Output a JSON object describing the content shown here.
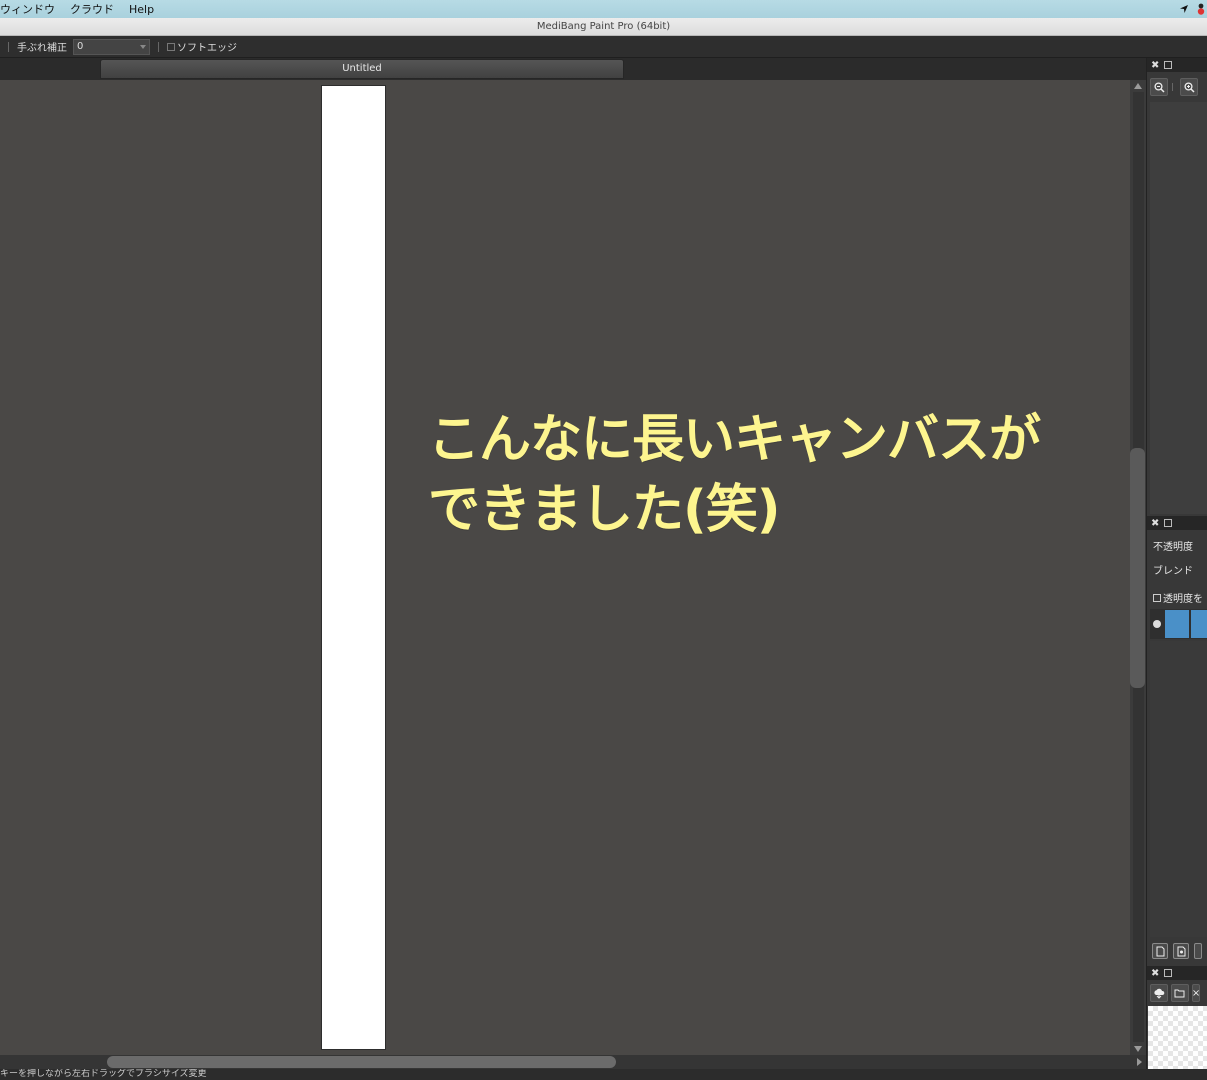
{
  "menubar": {
    "items": [
      "ウィンドウ",
      "クラウド",
      "Help"
    ]
  },
  "window": {
    "title": "MediBang Paint Pro (64bit)"
  },
  "tool_options": {
    "stabilizer_label": "手ぶれ補正",
    "stabilizer_value": "0",
    "soft_edge_label": "ソフトエッジ"
  },
  "document": {
    "tab_title": "Untitled"
  },
  "annotation": {
    "text": "こんなに長いキャンバスが\nできました(笑)",
    "color": "#fdf58f"
  },
  "layer_panel": {
    "opacity_label": "不透明度",
    "blend_label": "ブレンド",
    "protect_alpha_label": "透明度を"
  },
  "status": {
    "text": "キーを押しながら左右ドラッグでブラシサイズ変更"
  },
  "colors": {
    "canvas_bg": "#4a4846",
    "paper": "#ffffff",
    "layer_thumb": "#4a90c8"
  }
}
